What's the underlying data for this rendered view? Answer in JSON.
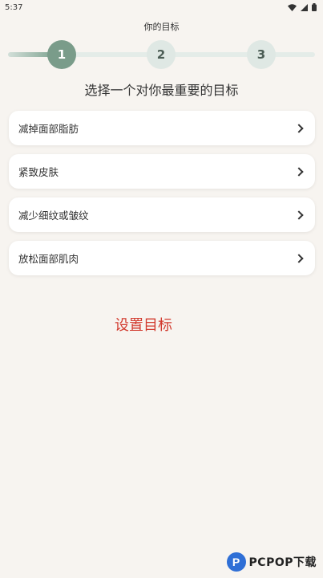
{
  "status_bar": {
    "time": "5:37"
  },
  "header": {
    "title": "你的目标"
  },
  "stepper": {
    "steps": [
      "1",
      "2",
      "3"
    ],
    "current": 1
  },
  "question": "选择一个对你最重要的目标",
  "options": [
    {
      "label": "减掉面部脂肪"
    },
    {
      "label": "紧致皮肤"
    },
    {
      "label": "减少细纹或皱纹"
    },
    {
      "label": "放松面部肌肉"
    }
  ],
  "action": {
    "label": "设置目标"
  },
  "watermark": {
    "logo": "P",
    "text": "PCPOP下载"
  },
  "colors": {
    "accent": "#7a9c8a",
    "action": "#d23a2e",
    "background": "#f7f4f0"
  }
}
